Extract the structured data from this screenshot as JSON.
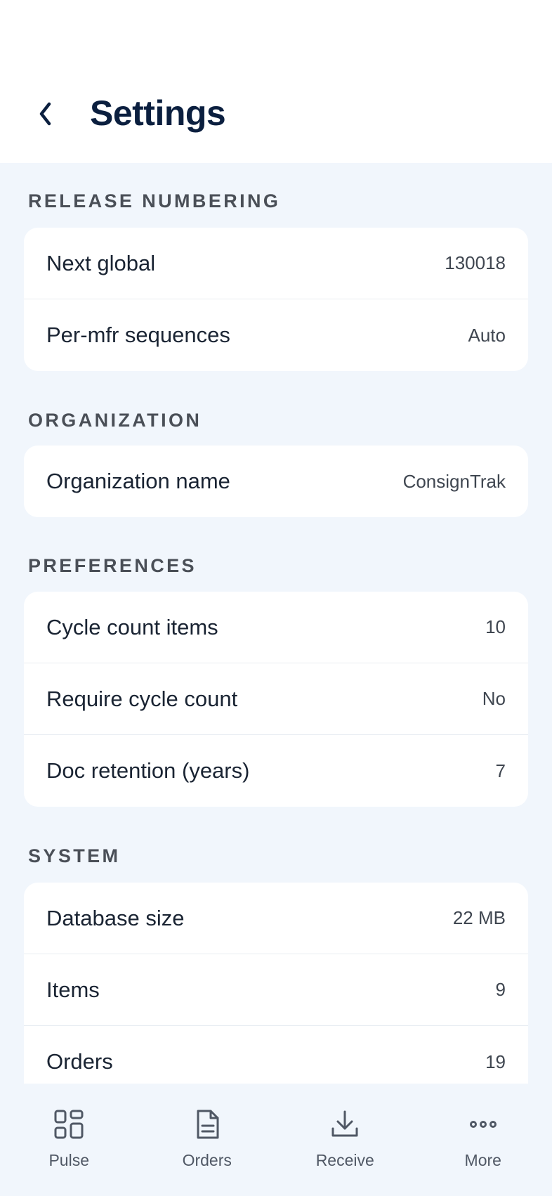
{
  "header": {
    "title": "Settings",
    "back_icon": "chevron-left-icon"
  },
  "sections": [
    {
      "title": "RELEASE NUMBERING",
      "rows": [
        {
          "label": "Next global",
          "value": "130018"
        },
        {
          "label": "Per-mfr sequences",
          "value": "Auto"
        }
      ]
    },
    {
      "title": "ORGANIZATION",
      "rows": [
        {
          "label": "Organization name",
          "value": "ConsignTrak"
        }
      ]
    },
    {
      "title": "PREFERENCES",
      "rows": [
        {
          "label": "Cycle count items",
          "value": "10"
        },
        {
          "label": "Require cycle count",
          "value": "No"
        },
        {
          "label": "Doc retention (years)",
          "value": "7"
        }
      ]
    },
    {
      "title": "SYSTEM",
      "rows": [
        {
          "label": "Database size",
          "value": "22 MB"
        },
        {
          "label": "Items",
          "value": "9"
        },
        {
          "label": "Orders",
          "value": "19"
        }
      ]
    }
  ],
  "nav": {
    "items": [
      {
        "label": "Pulse",
        "icon": "grid-icon"
      },
      {
        "label": "Orders",
        "icon": "document-icon"
      },
      {
        "label": "Receive",
        "icon": "download-icon"
      },
      {
        "label": "More",
        "icon": "more-icon"
      }
    ]
  },
  "colors": {
    "title": "#0b1f3f",
    "background": "#f1f6fc",
    "card": "#ffffff",
    "section_header": "#4a4f57"
  }
}
